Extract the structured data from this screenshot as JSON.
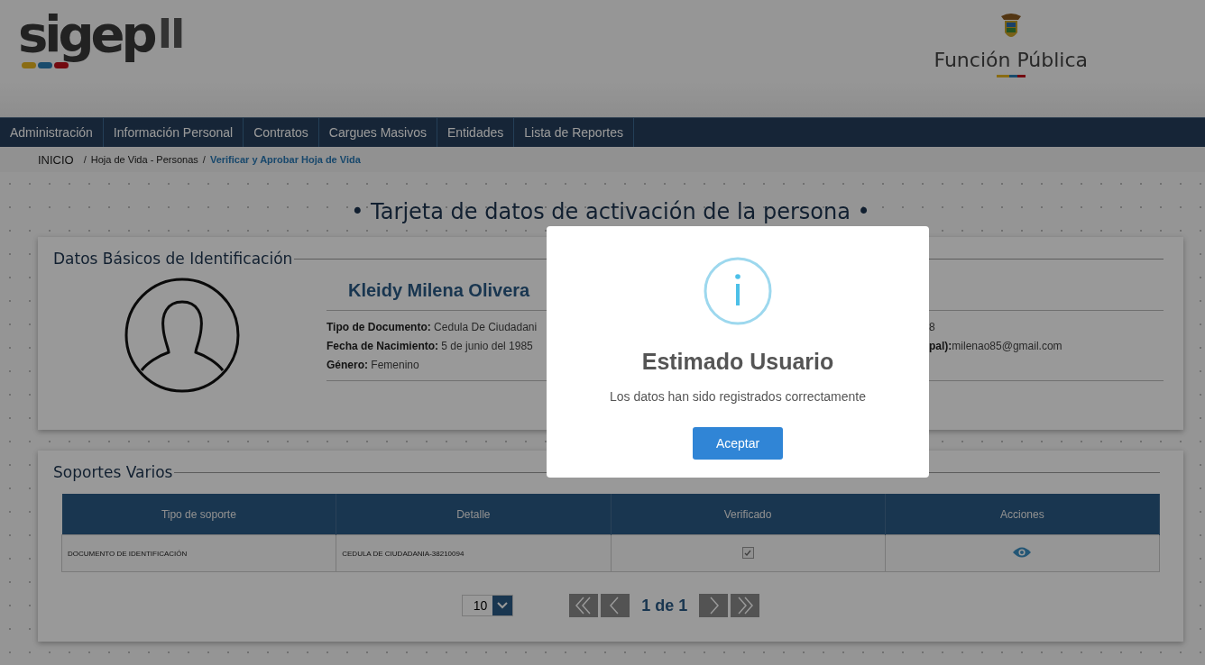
{
  "header": {
    "logo": "sigep",
    "logo_suffix": "II",
    "agency": "Función Pública"
  },
  "nav": [
    {
      "label": "Administración"
    },
    {
      "label": "Información Personal"
    },
    {
      "label": "Contratos"
    },
    {
      "label": "Cargues Masivos"
    },
    {
      "label": "Entidades"
    },
    {
      "label": "Lista de Reportes"
    }
  ],
  "breadcrumb_separator": "/",
  "breadcrumb": [
    {
      "label": "INICIO",
      "current": false
    },
    {
      "label": "Hoja de Vida - Personas",
      "current": false
    },
    {
      "label": "Verificar y Aprobar Hoja de Vida",
      "current": true
    }
  ],
  "page_title": "• Tarjeta de datos de activación de la persona •",
  "identification": {
    "legend": "Datos Básicos de Identificación",
    "name": "Kleidy Milena Olivera",
    "left_fields": [
      {
        "label": "Tipo de Documento:",
        "value": "Cedula De Ciudadani"
      },
      {
        "label": "Fecha de Nacimiento:",
        "value": "5 de junio del 1985"
      },
      {
        "label": "Género:",
        "value": "Femenino"
      }
    ],
    "right_fields": [
      {
        "value": "8"
      },
      {
        "label": "pal):",
        "value": "milenao85@gmail.com"
      }
    ]
  },
  "supports": {
    "legend": "Soportes Varios",
    "columns": [
      "Tipo de soporte",
      "Detalle",
      "Verificado",
      "Acciones"
    ],
    "rows": [
      {
        "type": "DOCUMENTO DE IDENTIFICACIÓN",
        "detail": "CEDULA DE CIUDADANIA-38210094",
        "verified": true
      }
    ],
    "page_size": "10",
    "page_label": "1 de 1"
  },
  "modal": {
    "title": "Estimado Usuario",
    "message": "Los datos han sido registrados correctamente",
    "button": "Aceptar"
  }
}
